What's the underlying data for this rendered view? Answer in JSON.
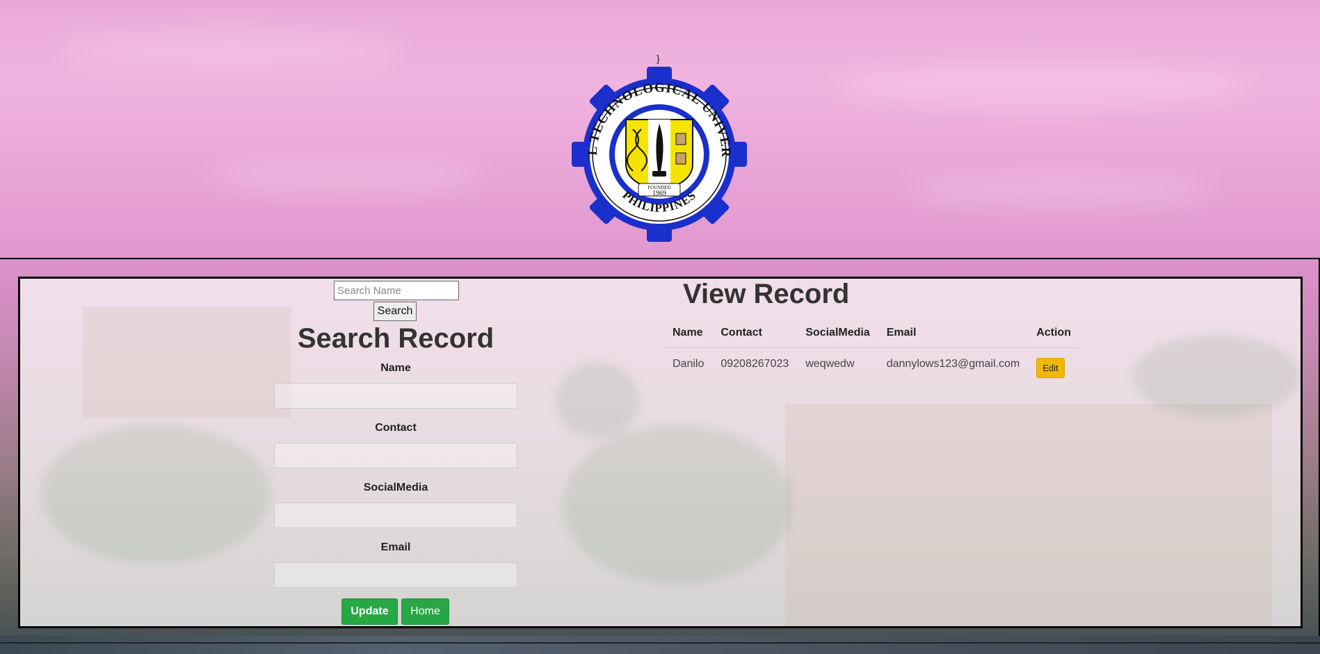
{
  "page": {
    "stray_text": "}"
  },
  "seal": {
    "top_text": "RIZAL TECHNOLOGICAL UNIVERSITY",
    "bottom_text": "PHILIPPINES",
    "founded_label": "FOUNDED",
    "founded_year": "1969",
    "colors": {
      "ring": "#1a2fcc",
      "gold": "#f5e400",
      "white": "#ffffff"
    }
  },
  "search_panel": {
    "search_input_placeholder": "Search Name",
    "search_button_label": "Search",
    "title": "Search Record",
    "fields": [
      {
        "label": "Name",
        "value": ""
      },
      {
        "label": "Contact",
        "value": ""
      },
      {
        "label": "SocialMedia",
        "value": ""
      },
      {
        "label": "Email",
        "value": ""
      }
    ],
    "update_button_label": "Update",
    "home_button_label": "Home"
  },
  "view_panel": {
    "title": "View Record",
    "columns": [
      "Name",
      "Contact",
      "SocialMedia",
      "Email",
      "Action"
    ],
    "rows": [
      {
        "name": "Danilo",
        "contact": "09208267023",
        "social_media": "weqwedw",
        "email": "dannylows123@gmail.com",
        "action_label": "Edit"
      }
    ]
  },
  "colors": {
    "green_button": "#28a745",
    "edit_button": "#f0b800"
  }
}
